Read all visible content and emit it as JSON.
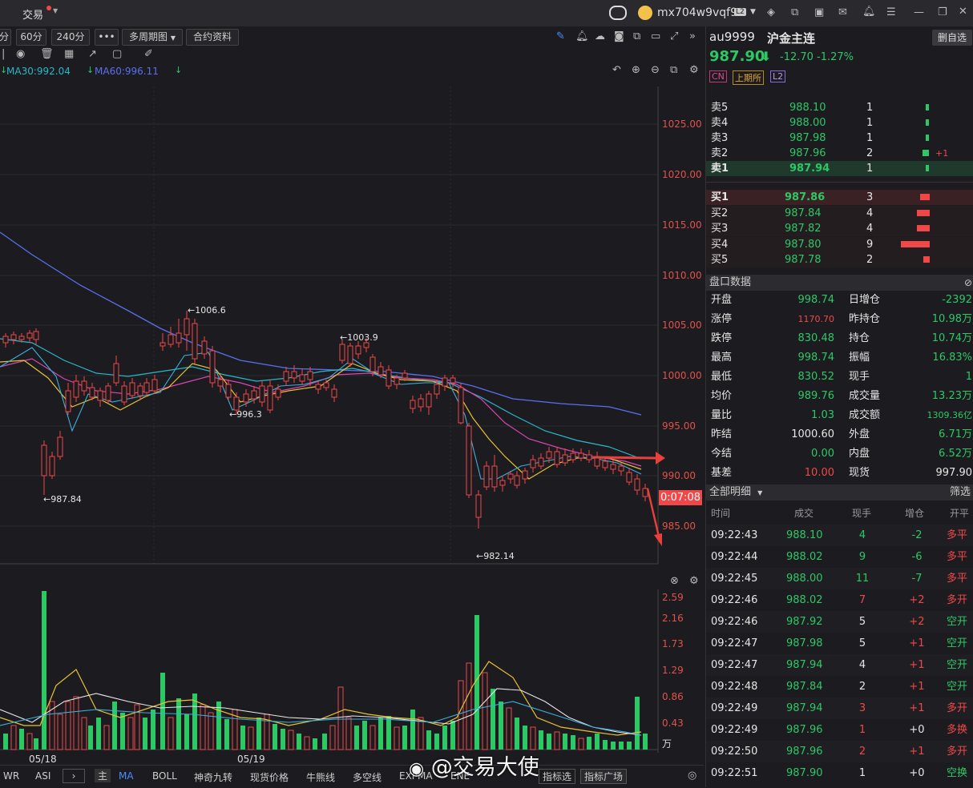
{
  "app": {
    "menu_trade": "交易",
    "username": "mx704w9vqf9",
    "level_badge": "L2"
  },
  "toolbar": {
    "period_cut": "分",
    "p60": "60分",
    "p240": "240分",
    "more": "•••",
    "multi_period": "多周期图",
    "contract_info": "合约资料"
  },
  "ma": {
    "ma30": "MA30:992.04",
    "ma60": "MA60:996.11"
  },
  "price_axis": [
    "1025.00",
    "1020.00",
    "1015.00",
    "1010.00",
    "1005.00",
    "1000.00",
    "995.00",
    "990.00",
    "985.00"
  ],
  "annotations": {
    "a1": "←1006.6",
    "a2": "←1003.9",
    "a3": "←996.3",
    "a4": "←987.84",
    "a5": "←982.14"
  },
  "countdown": "0:07:08",
  "vol_axis": [
    "2.59",
    "2.16",
    "1.73",
    "1.29",
    "0.86",
    "0.43"
  ],
  "vol_unit": "万",
  "dates": {
    "d1": "05/18",
    "d2": "05/19"
  },
  "bottom_tabs": [
    "WR",
    "ASI",
    "主",
    "MA",
    "BOLL",
    "神奇九转",
    "现货价格",
    "牛熊线",
    "多空线",
    "EXPMA",
    "ENE",
    "指标选",
    "指标广场"
  ],
  "watermark": "@交易大使",
  "quote": {
    "code": "au9999",
    "name": "沪金主连",
    "button": "删自选",
    "price": "987.90",
    "change": "-12.70",
    "change_pct": "-1.27%",
    "badge_cn": "CN",
    "badge_exch": "上期所",
    "badge_l2": "L2"
  },
  "asks": [
    {
      "label": "卖5",
      "price": "988.10",
      "vol": "1",
      "extra": ""
    },
    {
      "label": "卖4",
      "price": "988.00",
      "vol": "1",
      "extra": ""
    },
    {
      "label": "卖3",
      "price": "987.98",
      "vol": "1",
      "extra": ""
    },
    {
      "label": "卖2",
      "price": "987.96",
      "vol": "2",
      "extra": "+1"
    },
    {
      "label": "卖1",
      "price": "987.94",
      "vol": "1",
      "extra": ""
    }
  ],
  "bids": [
    {
      "label": "买1",
      "price": "987.86",
      "vol": "3"
    },
    {
      "label": "买2",
      "price": "987.84",
      "vol": "4"
    },
    {
      "label": "买3",
      "price": "987.82",
      "vol": "4"
    },
    {
      "label": "买4",
      "price": "987.80",
      "vol": "9"
    },
    {
      "label": "买5",
      "price": "987.78",
      "vol": "2"
    }
  ],
  "panel_title": "盘口数据",
  "panel": [
    {
      "l": "开盘",
      "v": "998.74",
      "l2": "日增仓",
      "v2": "-2392"
    },
    {
      "l": "涨停",
      "v": "1170.70",
      "l2": "昨持仓",
      "v2": "10.98万"
    },
    {
      "l": "跌停",
      "v": "830.48",
      "l2": "持仓",
      "v2": "10.74万"
    },
    {
      "l": "最高",
      "v": "998.74",
      "l2": "振幅",
      "v2": "16.83%"
    },
    {
      "l": "最低",
      "v": "830.52",
      "l2": "现手",
      "v2": "1"
    },
    {
      "l": "均价",
      "v": "989.76",
      "l2": "成交量",
      "v2": "13.23万"
    },
    {
      "l": "量比",
      "v": "1.03",
      "l2": "成交额",
      "v2": "1309.36亿"
    },
    {
      "l": "昨结",
      "v": "1000.60",
      "l2": "外盘",
      "v2": "6.71万"
    },
    {
      "l": "今结",
      "v": "0.00",
      "l2": "内盘",
      "v2": "6.52万"
    },
    {
      "l": "基差",
      "v": "10.00",
      "l2": "现货",
      "v2": "997.90"
    }
  ],
  "trades_title": "全部明细",
  "trades_filter": "筛选",
  "trades_header": [
    "时间",
    "成交",
    "现手",
    "增仓",
    "开平"
  ],
  "trades": [
    {
      "t": "09:22:43",
      "p": "988.10",
      "v": "4",
      "d": "-2",
      "k": "多平"
    },
    {
      "t": "09:22:44",
      "p": "988.02",
      "v": "9",
      "d": "-6",
      "k": "多平"
    },
    {
      "t": "09:22:45",
      "p": "988.00",
      "v": "11",
      "d": "-7",
      "k": "多平"
    },
    {
      "t": "09:22:46",
      "p": "988.02",
      "v": "7",
      "d": "+2",
      "k": "多开"
    },
    {
      "t": "09:22:46",
      "p": "987.92",
      "v": "5",
      "d": "+2",
      "k": "空开"
    },
    {
      "t": "09:22:47",
      "p": "987.98",
      "v": "5",
      "d": "+1",
      "k": "空开"
    },
    {
      "t": "09:22:47",
      "p": "987.94",
      "v": "4",
      "d": "+1",
      "k": "空开"
    },
    {
      "t": "09:22:48",
      "p": "987.84",
      "v": "2",
      "d": "+1",
      "k": "空开"
    },
    {
      "t": "09:22:49",
      "p": "987.94",
      "v": "3",
      "d": "+1",
      "k": "多开"
    },
    {
      "t": "09:22:49",
      "p": "987.96",
      "v": "1",
      "d": "+0",
      "k": "多换"
    },
    {
      "t": "09:22:50",
      "p": "987.96",
      "v": "2",
      "d": "+1",
      "k": "多开"
    },
    {
      "t": "09:22:51",
      "p": "987.90",
      "v": "1",
      "d": "+0",
      "k": "空换"
    }
  ]
}
